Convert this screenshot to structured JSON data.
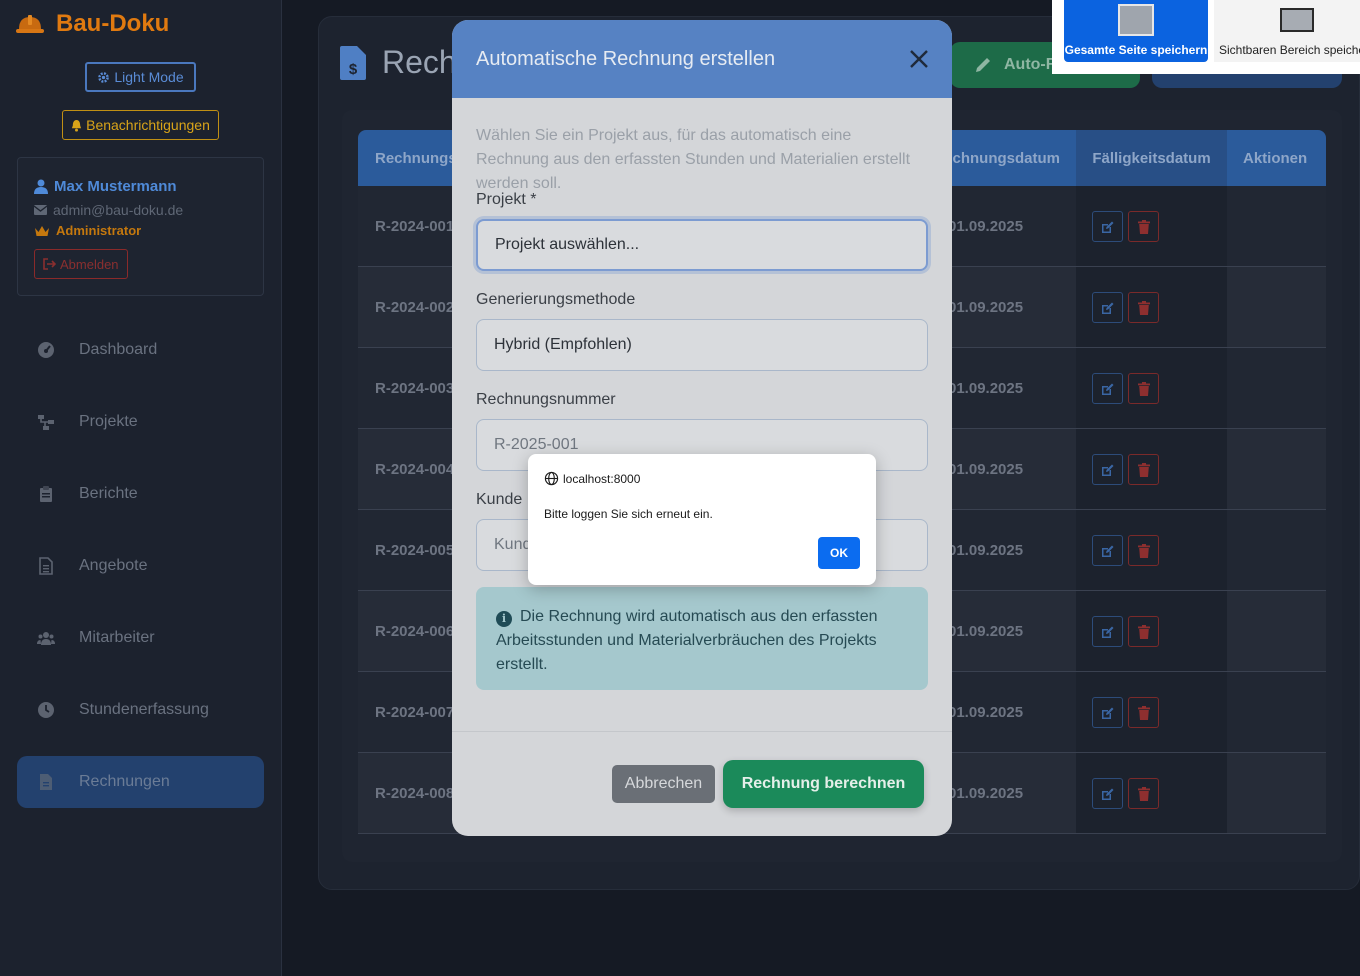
{
  "sidebar": {
    "brand": "Bau-Doku",
    "light_mode": "Light Mode",
    "notifications": "Benachrichtigungen",
    "user": {
      "name": "Max Mustermann",
      "email": "admin@bau-doku.de",
      "role": "Administrator",
      "logout": "Abmelden"
    },
    "nav": [
      {
        "label": "Dashboard",
        "icon": "gauge-icon"
      },
      {
        "label": "Projekte",
        "icon": "sitemap-icon"
      },
      {
        "label": "Berichte",
        "icon": "clipboard-icon"
      },
      {
        "label": "Angebote",
        "icon": "file-text-icon"
      },
      {
        "label": "Mitarbeiter",
        "icon": "users-icon"
      },
      {
        "label": "Stundenerfassung",
        "icon": "clock-icon"
      },
      {
        "label": "Rechnungen",
        "icon": "invoice-icon",
        "active": true
      }
    ]
  },
  "main": {
    "title": "Rechnungen",
    "auto_button": "Auto-Rechnung",
    "table": {
      "headers": [
        "Rechnungsnummer",
        "Rechnungsdatum",
        "Fälligkeitsdatum",
        "Aktionen"
      ],
      "rows": [
        {
          "number": "R-2024-001",
          "date": "01.09.2025"
        },
        {
          "number": "R-2024-002",
          "date": "01.09.2025"
        },
        {
          "number": "R-2024-003",
          "date": "01.09.2025"
        },
        {
          "number": "R-2024-004",
          "date": "01.09.2025"
        },
        {
          "number": "R-2024-005",
          "date": "01.09.2025"
        },
        {
          "number": "R-2024-006",
          "date": "01.09.2025"
        },
        {
          "number": "R-2024-007",
          "date": "01.09.2025"
        },
        {
          "number": "R-2024-008",
          "date": "01.09.2025"
        }
      ]
    }
  },
  "modal": {
    "title": "Automatische Rechnung erstellen",
    "description": "Wählen Sie ein Projekt aus, für das automatisch eine Rechnung aus den erfassten Stunden und Materialien erstellt werden soll.",
    "project_label": "Projekt *",
    "project_value": "Projekt auswählen...",
    "method_label": "Generierungsmethode",
    "method_value": "Hybrid (Empfohlen)",
    "number_label": "Rechnungsnummer",
    "number_value": "R-2025-001",
    "customer_label": "Kunde",
    "customer_placeholder": "Kunde",
    "info": "Die Rechnung wird automatisch aus den erfassten Arbeitsstunden und Materialverbräuchen des Projekts erstellt.",
    "cancel": "Abbrechen",
    "submit": "Rechnung berechnen"
  },
  "alert": {
    "origin": "localhost:8000",
    "message": "Bitte loggen Sie sich erneut ein.",
    "ok": "OK"
  },
  "extension": {
    "full_page": "Gesamte Seite speichern",
    "visible_area": "Sichtbaren Bereich speichern"
  }
}
